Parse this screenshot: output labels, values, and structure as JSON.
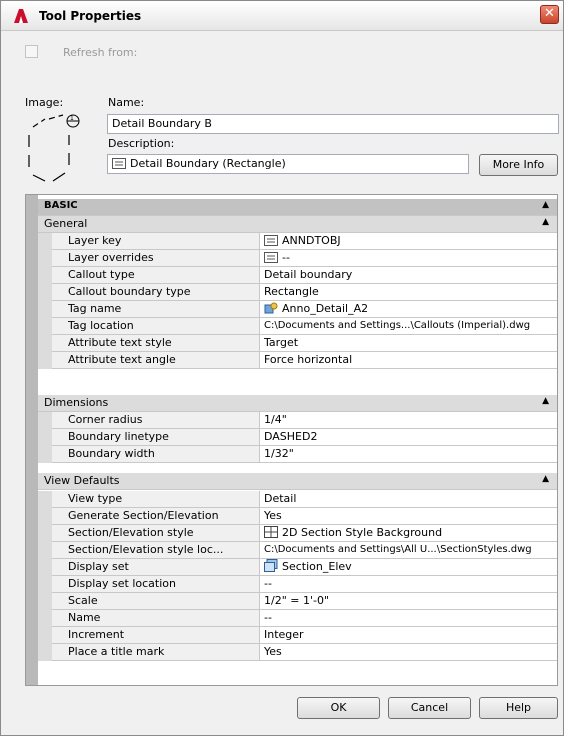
{
  "window": {
    "title": "Tool Properties",
    "close_glyph": "✕"
  },
  "refresh": {
    "label": "Refresh from:",
    "checked": false
  },
  "image_label": "Image:",
  "name": {
    "label": "Name:",
    "value": "Detail Boundary B"
  },
  "description": {
    "label": "Description:",
    "value": "Detail Boundary (Rectangle)",
    "icon": "text-icon"
  },
  "more_info_button": "More Info",
  "properties": {
    "basic_label": "BASIC",
    "categories": [
      {
        "label": "General",
        "rows": [
          {
            "name": "Layer key",
            "value": "ANNDTOBJ",
            "icon": "text-icon"
          },
          {
            "name": "Layer overrides",
            "value": "--",
            "icon": "text-icon"
          },
          {
            "name": "Callout type",
            "value": "Detail boundary"
          },
          {
            "name": "Callout boundary type",
            "value": "Rectangle"
          },
          {
            "name": "Tag name",
            "value": "Anno_Detail_A2",
            "icon": "block-icon"
          },
          {
            "name": "Tag location",
            "value": "C:\\Documents and Settings...\\Callouts (Imperial).dwg"
          },
          {
            "name": "Attribute text style",
            "value": "Target"
          },
          {
            "name": "Attribute text angle",
            "value": "Force horizontal"
          }
        ]
      },
      {
        "label": "Dimensions",
        "rows": [
          {
            "name": "Corner radius",
            "value": "1/4\""
          },
          {
            "name": "Boundary linetype",
            "value": "DASHED2"
          },
          {
            "name": "Boundary width",
            "value": "1/32\""
          }
        ]
      },
      {
        "label": "View Defaults",
        "rows": [
          {
            "name": "View type",
            "value": "Detail"
          },
          {
            "name": "Generate Section/Elevation",
            "value": "Yes"
          },
          {
            "name": "Section/Elevation style",
            "value": "2D Section Style Background",
            "icon": "grid-icon"
          },
          {
            "name": "Section/Elevation style loc...",
            "value": "C:\\Documents and Settings\\All U...\\SectionStyles.dwg"
          },
          {
            "name": "Display set",
            "value": "Section_Elev",
            "icon": "display-set-icon"
          },
          {
            "name": "Display set location",
            "value": "--"
          },
          {
            "name": "Scale",
            "value": "1/2\" = 1'-0\""
          },
          {
            "name": "Name",
            "value": "--"
          },
          {
            "name": "Increment",
            "value": "Integer"
          },
          {
            "name": "Place a title mark",
            "value": "Yes"
          }
        ]
      }
    ]
  },
  "buttons": {
    "ok": "OK",
    "cancel": "Cancel",
    "help": "Help"
  }
}
